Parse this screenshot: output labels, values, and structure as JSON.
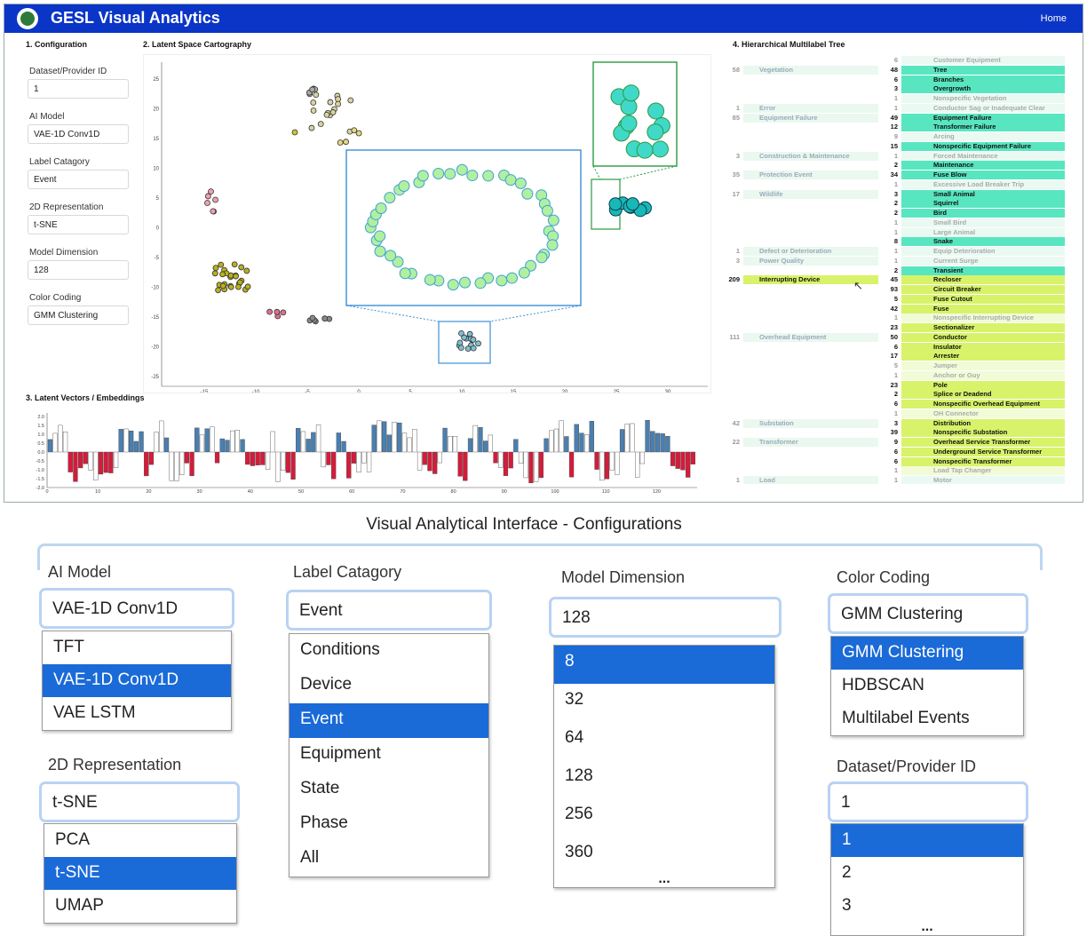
{
  "app": {
    "title": "GESL Visual Analytics",
    "home": "Home"
  },
  "sections": {
    "config": "1. Configuration",
    "map": "2. Latent Space Cartography",
    "vectors": "3. Latent Vectors / Embeddings",
    "tree": "4. Hierarchical Multilabel Tree"
  },
  "config": [
    {
      "label": "Dataset/Provider ID",
      "value": "1"
    },
    {
      "label": "AI Model",
      "value": "VAE-1D Conv1D"
    },
    {
      "label": "Label Catagory",
      "value": "Event"
    },
    {
      "label": "2D Representation",
      "value": "t-SNE"
    },
    {
      "label": "Model Dimension",
      "value": "128"
    },
    {
      "label": "Color Coding",
      "value": "GMM Clustering"
    }
  ],
  "colors": {
    "topbar": "#0a35c7",
    "select_highlight": "#1a6ad8",
    "positive_bar": "#4a7fb0",
    "negative_bar": "#d41c3a"
  },
  "map_axes": {
    "x_ticks": [
      "-15",
      "-10",
      "-5",
      "0",
      "5",
      "10",
      "15",
      "20",
      "25",
      "30"
    ],
    "y_ticks": [
      "25",
      "20",
      "15",
      "10",
      "5",
      "0",
      "-5",
      "-10",
      "-15",
      "-20",
      "-25"
    ]
  },
  "vector_axes": {
    "x_ticks": [
      "0",
      "10",
      "20",
      "30",
      "40",
      "50",
      "60",
      "70",
      "80",
      "90",
      "100",
      "110",
      "120"
    ],
    "y_ticks": [
      "2.0",
      "1.5",
      "1.0",
      "0.5",
      "0.0",
      "-0.5",
      "-1.0",
      "-1.5",
      "-2.0"
    ]
  },
  "tree_parents": [
    {
      "count": "58",
      "label": "Vegetation"
    },
    {
      "count": "1",
      "label": "Error"
    },
    {
      "count": "85",
      "label": "Equipment Failure"
    },
    {
      "count": "3",
      "label": "Construction & Maintenance"
    },
    {
      "count": "35",
      "label": "Protection Event"
    },
    {
      "count": "17",
      "label": "Wildlife"
    },
    {
      "count": "1",
      "label": "Defect or Deterioration"
    },
    {
      "count": "3",
      "label": "Power Quality"
    },
    {
      "count": "209",
      "label": "Interrupting Device"
    },
    {
      "count": "111",
      "label": "Overhead Equipment"
    },
    {
      "count": "42",
      "label": "Substation"
    },
    {
      "count": "22",
      "label": "Transformer"
    },
    {
      "count": "1",
      "label": "Load"
    }
  ],
  "tree_children": [
    {
      "count": "6",
      "label": "Customer Equipment"
    },
    {
      "count": "48",
      "label": "Tree"
    },
    {
      "count": "6",
      "label": "Branches"
    },
    {
      "count": "3",
      "label": "Overgrowth"
    },
    {
      "count": "1",
      "label": "Nonspecific Vegetation"
    },
    {
      "count": "1",
      "label": "Conductor Sag or Inadequate Clear"
    },
    {
      "count": "49",
      "label": "Equipment Failure"
    },
    {
      "count": "12",
      "label": "Transformer Failure"
    },
    {
      "count": "9",
      "label": "Arcing"
    },
    {
      "count": "15",
      "label": "Nonspecific Equipment Failure"
    },
    {
      "count": "1",
      "label": "Forced Maintenance"
    },
    {
      "count": "2",
      "label": "Maintenance"
    },
    {
      "count": "34",
      "label": "Fuse Blow"
    },
    {
      "count": "1",
      "label": "Excessive Load Breaker Trip"
    },
    {
      "count": "3",
      "label": "Small Animal"
    },
    {
      "count": "2",
      "label": "Squirrel"
    },
    {
      "count": "2",
      "label": "Bird"
    },
    {
      "count": "1",
      "label": "Small Bird"
    },
    {
      "count": "1",
      "label": "Large Animal"
    },
    {
      "count": "8",
      "label": "Snake"
    },
    {
      "count": "1",
      "label": "Equip Deterioration"
    },
    {
      "count": "1",
      "label": "Current Surge"
    },
    {
      "count": "2",
      "label": "Transient"
    },
    {
      "count": "45",
      "label": "Recloser"
    },
    {
      "count": "93",
      "label": "Circuit Breaker"
    },
    {
      "count": "5",
      "label": "Fuse Cutout"
    },
    {
      "count": "42",
      "label": "Fuse"
    },
    {
      "count": "1",
      "label": "Nonspecific Interrupting Device"
    },
    {
      "count": "23",
      "label": "Sectionalizer"
    },
    {
      "count": "50",
      "label": "Conductor"
    },
    {
      "count": "6",
      "label": "Insulator"
    },
    {
      "count": "17",
      "label": "Arrester"
    },
    {
      "count": "5",
      "label": "Jumper"
    },
    {
      "count": "1",
      "label": "Anchor or Guy"
    },
    {
      "count": "23",
      "label": "Pole"
    },
    {
      "count": "2",
      "label": "Splice or Deadend"
    },
    {
      "count": "6",
      "label": "Nonspecific Overhead Equipment"
    },
    {
      "count": "1",
      "label": "OH Connector"
    },
    {
      "count": "3",
      "label": "Distribution"
    },
    {
      "count": "39",
      "label": "Nonspecific Substation"
    },
    {
      "count": "9",
      "label": "Overhead Service Transformer"
    },
    {
      "count": "6",
      "label": "Underground Service Transformer"
    },
    {
      "count": "6",
      "label": "Nonspecific Transformer"
    },
    {
      "count": "1",
      "label": "Load Tap Changer"
    },
    {
      "count": "1",
      "label": "Motor"
    }
  ],
  "caption": "Visual Analytical Interface - Configurations",
  "dropdowns": {
    "ai_model": {
      "label": "AI Model",
      "value": "VAE-1D Conv1D",
      "options": [
        "TFT",
        "VAE-1D Conv1D",
        "VAE LSTM"
      ],
      "selected": 1
    },
    "label_category": {
      "label": "Label Catagory",
      "value": "Event",
      "options": [
        "Conditions",
        "Device",
        "Event",
        "Equipment",
        "State",
        "Phase",
        "All"
      ],
      "selected": 2
    },
    "model_dimension": {
      "label": "Model Dimension",
      "value": "128",
      "options": [
        "8",
        "32",
        "64",
        "128",
        "256",
        "360"
      ],
      "selected": 0,
      "more": "..."
    },
    "color_coding": {
      "label": "Color Coding",
      "value": "GMM Clustering",
      "options": [
        "GMM Clustering",
        "HDBSCAN",
        "Multilabel Events"
      ],
      "selected": 0
    },
    "representation": {
      "label": "2D Representation",
      "value": "t-SNE",
      "options": [
        "PCA",
        "t-SNE",
        "UMAP"
      ],
      "selected": 1
    },
    "dataset": {
      "label": "Dataset/Provider ID",
      "value": "1",
      "options": [
        "1",
        "2",
        "3"
      ],
      "selected": 0,
      "more": "..."
    }
  }
}
